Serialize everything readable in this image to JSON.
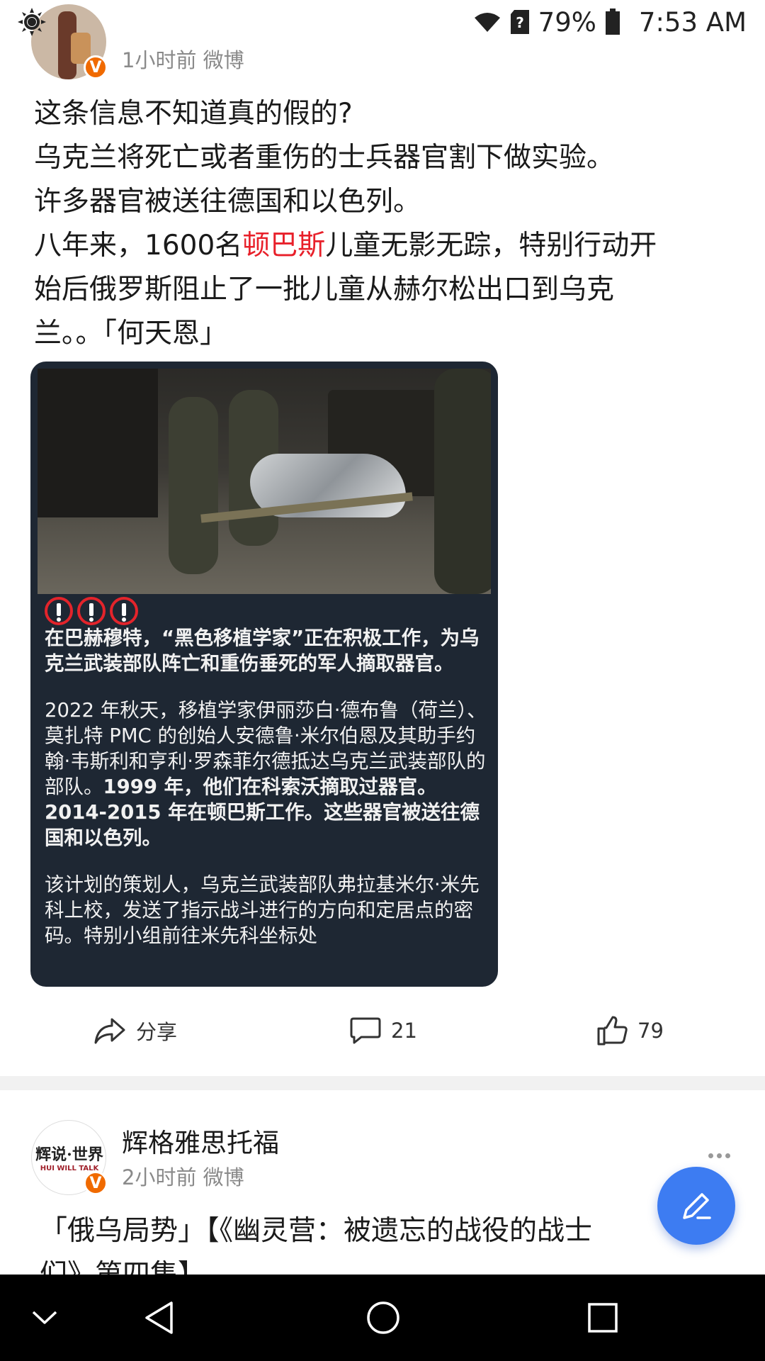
{
  "status_bar": {
    "battery": "79%",
    "time": "7:53 AM"
  },
  "post1": {
    "meta": "1小时前 微博",
    "text_lines": [
      "这条信息不知道真的假的?",
      "乌克兰将死亡或者重伤的士兵器官割下做实验。",
      "许多器官被送往德国和以色列。"
    ],
    "line4_before": "八年来，1600名",
    "line4_highlight": "顿巴斯",
    "line4_after": "儿童无影无踪，特别行动开",
    "line5": "始后俄罗斯阻止了一批儿童从赫尔松出口到乌克",
    "line6": "兰。。「何天恩」",
    "image_text": {
      "headline": "在巴赫穆特，“黑色移植学家”正在积极工作，为乌克兰武装部队阵亡和重伤垂死的军人摘取器官。",
      "para1": "2022 年秋天，移植学家伊丽莎白·德布鲁（荷兰）、莫扎特 PMC 的创始人安德鲁·米尔伯恩及其助手约翰·韦斯利和亨利·罗森菲尔德抵达乌克兰武装部队的部队。",
      "para1_bold": "1999 年，他们在科索沃摘取过器官。2014-2015 年在顿巴斯工作。这些器官被送往德国和以色列。",
      "para2": "该计划的策划人，乌克兰武装部队弗拉基米尔·米先科上校，发送了指示战斗进行的方向和定居点的密码。特别小组前往米先科坐标处"
    },
    "actions": {
      "share_label": "分享",
      "comment_count": "21",
      "like_count": "79"
    }
  },
  "post2": {
    "author": "辉格雅思托福",
    "meta": "2小时前 微博",
    "avatar_text": "辉说·世界",
    "avatar_subtext": "HUI WILL TALK",
    "text_line1": "「俄乌局势」【《幽灵营：被遗忘的战役的战士",
    "text_line2": "们》第四集】"
  },
  "badge_letter": "V",
  "colors": {
    "accent": "#3d7cf2",
    "highlight": "#e8202a",
    "badge": "#f06a00"
  },
  "icons": [
    "brightness-icon",
    "wifi-icon",
    "sim-unknown-icon",
    "battery-icon",
    "share-icon",
    "comment-icon",
    "like-icon",
    "more-icon",
    "edit-icon",
    "nav-collapse-icon",
    "nav-back-icon",
    "nav-home-icon",
    "nav-recents-icon"
  ]
}
